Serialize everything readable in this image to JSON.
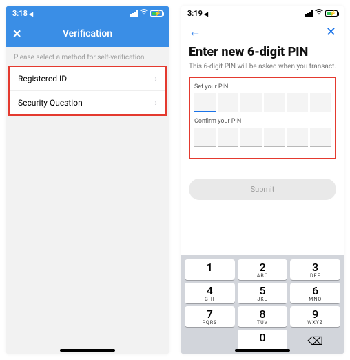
{
  "left": {
    "status_time": "3:18",
    "status_time_suffix": "◀",
    "header_title": "Verification",
    "close_glyph": "✕",
    "instruction": "Please select a method for self-verification",
    "options": [
      {
        "label": "Registered ID"
      },
      {
        "label": "Security Question"
      }
    ],
    "chevron_glyph": "›"
  },
  "right": {
    "status_time": "3:19",
    "status_time_suffix": "◀",
    "back_glyph": "←",
    "close_glyph": "✕",
    "title": "Enter new 6-digit PIN",
    "subtitle": "This 6-digit PIN will be asked when you transact.",
    "set_label": "Set your PIN",
    "confirm_label": "Confirm your PIN",
    "submit_label": "Submit",
    "keypad": {
      "keys": [
        [
          {
            "d": "1",
            "l": ""
          },
          {
            "d": "2",
            "l": "ABC"
          },
          {
            "d": "3",
            "l": "DEF"
          }
        ],
        [
          {
            "d": "4",
            "l": "GHI"
          },
          {
            "d": "5",
            "l": "JKL"
          },
          {
            "d": "6",
            "l": "MNO"
          }
        ],
        [
          {
            "d": "7",
            "l": "PQRS"
          },
          {
            "d": "8",
            "l": "TUV"
          },
          {
            "d": "9",
            "l": "WXYZ"
          }
        ]
      ],
      "zero": {
        "d": "0",
        "l": ""
      },
      "delete_glyph": "⌫"
    }
  }
}
